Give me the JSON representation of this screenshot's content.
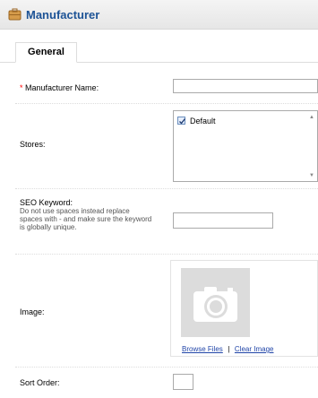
{
  "header": {
    "title": "Manufacturer",
    "icon": "briefcase-icon"
  },
  "tabs": [
    {
      "label": "General"
    }
  ],
  "form": {
    "manufacturer_name": {
      "required_mark": "*",
      "label": "Manufacturer Name:",
      "value": ""
    },
    "stores": {
      "label": "Stores:",
      "options": [
        {
          "label": "Default",
          "checked": true
        }
      ]
    },
    "seo_keyword": {
      "label": "SEO Keyword:",
      "hint": "Do not use spaces instead replace spaces with - and make sure the keyword is globally unique.",
      "value": ""
    },
    "image": {
      "label": "Image:",
      "browse": "Browse Files",
      "separator": "|",
      "clear": "Clear Image"
    },
    "sort_order": {
      "label": "Sort Order:",
      "value": ""
    }
  },
  "colors": {
    "title": "#1d5396",
    "link": "#2145a8",
    "required": "#ff0000"
  }
}
